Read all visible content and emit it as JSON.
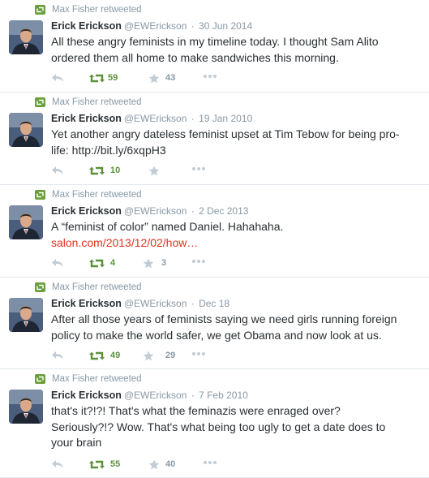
{
  "colors": {
    "retweet_green": "#5c913b",
    "muted": "#8899a6",
    "link": "#e0301e",
    "text": "#292f33"
  },
  "icons": [
    "retweet-icon",
    "reply-icon",
    "favorite-star-icon",
    "more-dots-icon"
  ],
  "tweets": [
    {
      "retweeted_by": "Max Fisher retweeted",
      "name": "Erick Erickson",
      "handle": "@EWErickson",
      "sep": "·",
      "date": "30 Jun 2014",
      "lines": [
        "All these angry feminists in my timeline today.  I thought Sam Alito",
        "ordered them all home to make sandwiches this morning."
      ],
      "retweets": "59",
      "favorites": "43"
    },
    {
      "retweeted_by": "Max Fisher retweeted",
      "name": "Erick Erickson",
      "handle": "@EWErickson",
      "sep": "·",
      "date": "19 Jan 2010",
      "lines": [
        "Yet another angry dateless feminist upset at Tim Tebow for being pro-",
        "life: http://bit.ly/6xqpH3"
      ],
      "retweets": "10",
      "favorites": ""
    },
    {
      "retweeted_by": "Max Fisher retweeted",
      "name": "Erick Erickson",
      "handle": "@EWErickson",
      "sep": "·",
      "date": "2 Dec 2013",
      "lines": [
        "A “feminist of color” named Daniel.  Hahahaha."
      ],
      "link": "salon.com/2013/12/02/how…",
      "retweets": "4",
      "favorites": "3"
    },
    {
      "retweeted_by": "Max Fisher retweeted",
      "name": "Erick Erickson",
      "handle": "@EWErickson",
      "sep": "·",
      "date": "Dec 18",
      "lines": [
        "After all those years of feminists saying we need girls running foreign",
        "policy to make the world safer, we get Obama and now look at us."
      ],
      "retweets": "49",
      "favorites": "29"
    },
    {
      "retweeted_by": "Max Fisher retweeted",
      "name": "Erick Erickson",
      "handle": "@EWErickson",
      "sep": "·",
      "date": "7 Feb 2010",
      "lines": [
        "that's it?!?!  That's what the feminazis were enraged over?",
        "Seriously?!?  Wow.  That's what being too ugly to get a date does to",
        "your brain"
      ],
      "retweets": "55",
      "favorites": "40"
    }
  ]
}
